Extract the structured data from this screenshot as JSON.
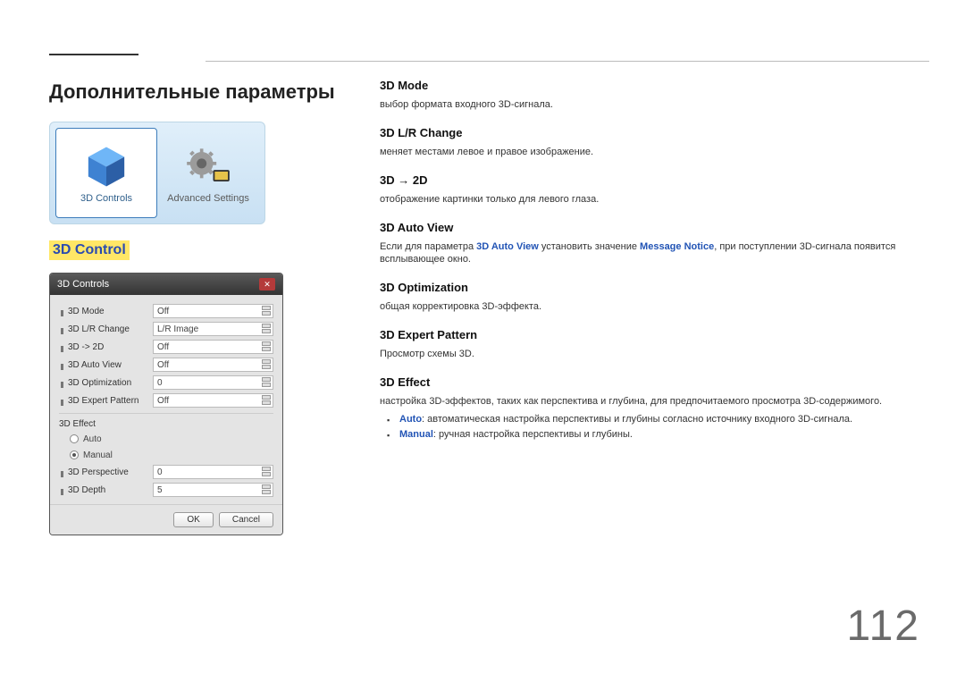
{
  "page_number": "112",
  "section_title": "Дополнительные параметры",
  "subsection_title": "3D Control",
  "banner": {
    "left_label": "3D Controls",
    "right_label": "Advanced Settings"
  },
  "dialog": {
    "title": "3D Controls",
    "rows": {
      "mode": {
        "label": "3D Mode",
        "value": "Off"
      },
      "lr": {
        "label": "3D L/R Change",
        "value": "L/R Image"
      },
      "to2d": {
        "label": "3D -> 2D",
        "value": "Off"
      },
      "autoview": {
        "label": "3D Auto View",
        "value": "Off"
      },
      "optim": {
        "label": "3D Optimization",
        "value": "0"
      },
      "pattern": {
        "label": "3D Expert Pattern",
        "value": "Off"
      }
    },
    "group_label": "3D Effect",
    "radios": {
      "auto": "Auto",
      "manual": "Manual"
    },
    "perspective": {
      "label": "3D Perspective",
      "value": "0"
    },
    "depth": {
      "label": "3D Depth",
      "value": "5"
    },
    "ok": "OK",
    "cancel": "Cancel"
  },
  "entries": {
    "mode": {
      "h": "3D Mode",
      "p": "выбор формата входного 3D-сигнала."
    },
    "lr": {
      "h": "3D L/R Change",
      "p": "меняет местами левое и правое изображение."
    },
    "to2d": {
      "h": "3D → 2D",
      "p": "отображение картинки только для левого глаза."
    },
    "autoview": {
      "h": "3D Auto View",
      "p_pre": "Если для параметра ",
      "p_link1": "3D Auto View",
      "p_mid": " установить значение ",
      "p_link2": "Message Notice",
      "p_post": ", при поступлении 3D-сигнала появится всплывающее окно."
    },
    "optim": {
      "h": "3D Optimization",
      "p": "общая корректировка 3D-эффекта."
    },
    "pattern": {
      "h": "3D Expert Pattern",
      "p": "Просмотр схемы 3D."
    },
    "effect": {
      "h": "3D Effect",
      "p": "настройка 3D-эффектов, таких как перспектива и глубина, для предпочитаемого просмотра 3D-содержимого.",
      "auto_label": "Auto",
      "auto_text": ": автоматическая настройка перспективы и глубины согласно источнику входного 3D-сигнала.",
      "manual_label": "Manual",
      "manual_text": ": ручная настройка перспективы и глубины."
    }
  }
}
